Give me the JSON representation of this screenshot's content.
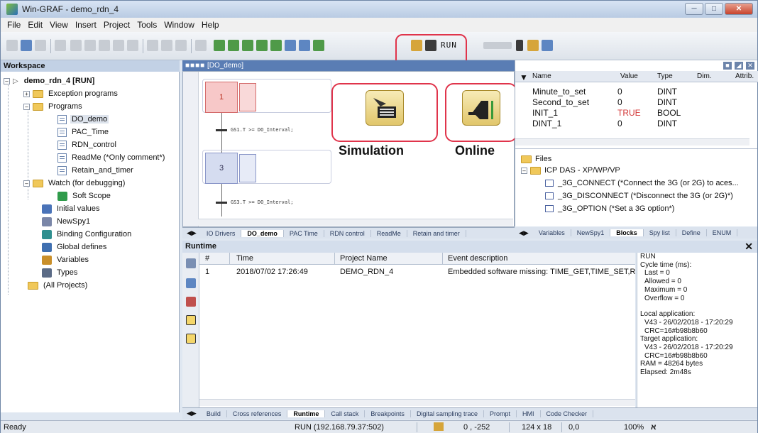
{
  "window": {
    "title": "Win-GRAF  - demo_rdn_4"
  },
  "menu": [
    "File",
    "Edit",
    "View",
    "Insert",
    "Project",
    "Tools",
    "Window",
    "Help"
  ],
  "toolbar": {
    "run_label": "RUN"
  },
  "workspace": {
    "header": "Workspace",
    "tree": [
      {
        "label": "demo_rdn_4 [RUN]",
        "icon": "project-icon",
        "level": 0,
        "bold": true
      },
      {
        "label": "Exception programs",
        "icon": "folder-icon",
        "level": 1
      },
      {
        "label": "Programs",
        "icon": "folder-icon",
        "level": 1
      },
      {
        "label": "DO_demo",
        "icon": "program-icon",
        "level": 2,
        "selected": true
      },
      {
        "label": "PAC_Time",
        "icon": "program-icon",
        "level": 2
      },
      {
        "label": "RDN_control",
        "icon": "program-icon",
        "level": 2
      },
      {
        "label": "ReadMe (*Only comment*)",
        "icon": "program-icon",
        "level": 2
      },
      {
        "label": "Retain_and_timer",
        "icon": "program-icon",
        "level": 2
      },
      {
        "label": "Watch (for debugging)",
        "icon": "folder-icon",
        "level": 1
      },
      {
        "label": "Soft Scope",
        "icon": "scope-icon",
        "level": 2
      },
      {
        "label": "Initial values",
        "icon": "initial-values-icon",
        "level": 1
      },
      {
        "label": "NewSpy1",
        "icon": "spy-icon",
        "level": 1
      },
      {
        "label": "Binding Configuration",
        "icon": "binding-icon",
        "level": 1
      },
      {
        "label": "Global defines",
        "icon": "defines-icon",
        "level": 1
      },
      {
        "label": "Variables",
        "icon": "variables-icon",
        "level": 1
      },
      {
        "label": "Types",
        "icon": "types-icon",
        "level": 1
      },
      {
        "label": "(All Projects)",
        "icon": "folder-icon",
        "level": 0
      }
    ]
  },
  "editor": {
    "title": "[DO_demo]",
    "steps": [
      "1",
      "3"
    ],
    "transitions": [
      "GS1.T >= DO_Interval;",
      "GS3.T >= DO_Interval;"
    ],
    "tabs": [
      "IO Drivers",
      "DO_demo",
      "PAC Time",
      "RDN control",
      "ReadMe",
      "Retain and timer"
    ],
    "active_tab": "DO_demo"
  },
  "callouts": {
    "simulation": "Simulation",
    "online": "Online"
  },
  "variables": {
    "columns": [
      "Name",
      "Value",
      "Type",
      "Dim.",
      "Attrib."
    ],
    "rows": [
      {
        "name": "Minute_to_set",
        "value": "0",
        "type": "DINT"
      },
      {
        "name": "Second_to_set",
        "value": "0",
        "type": "DINT"
      },
      {
        "name": "INIT_1",
        "value": "TRUE",
        "type": "BOOL"
      },
      {
        "name": "DINT_1",
        "value": "0",
        "type": "DINT"
      }
    ]
  },
  "blocks": {
    "items": [
      {
        "label": "Files",
        "icon": "folder-icon"
      },
      {
        "label": "ICP DAS - XP/WP/VP",
        "icon": "folder-icon"
      },
      {
        "label": "_3G_CONNECT (*Connect the 3G (or 2G) to aces...",
        "icon": "function-block-icon"
      },
      {
        "label": "_3G_DISCONNECT (*Disconnect the 3G (or 2G)*)",
        "icon": "function-block-icon"
      },
      {
        "label": "_3G_OPTION (*Set a 3G option*)",
        "icon": "function-block-icon"
      }
    ],
    "tabs": [
      "Variables",
      "NewSpy1",
      "Blocks",
      "Spy list",
      "Define",
      "ENUM"
    ]
  },
  "runtime": {
    "header": "Runtime",
    "columns": [
      "#",
      "Time",
      "Project Name",
      "Event description"
    ],
    "rows": [
      {
        "num": "1",
        "time": "2018/07/02 17:26:49",
        "project": "DEMO_RDN_4",
        "event": "Embedded software missing: TIME_GET,TIME_SET,RI"
      }
    ],
    "info": [
      "RUN",
      "Cycle time (ms):",
      "  Last = 0",
      "  Allowed = 0",
      "  Maximum = 0",
      "  Overflow = 0",
      "",
      "Local application:",
      "  V43 - 26/02/2018 - 17:20:29",
      "  CRC=16#b98b8b60",
      "Target application:",
      "  V43 - 26/02/2018 - 17:20:29",
      "  CRC=16#b98b8b60",
      "RAM = 48264 bytes",
      "Elapsed: 2m48s"
    ],
    "tabs": [
      "Build",
      "Cross references",
      "Runtime",
      "Call stack",
      "Breakpoints",
      "Digital sampling trace",
      "Prompt",
      "HMI",
      "Code Checker"
    ],
    "active_tab": "Runtime"
  },
  "status": {
    "ready": "Ready",
    "connection": "RUN (192.168.79.37:502)",
    "coords": "0 , -252",
    "size": "124 x 18",
    "pos": "0,0",
    "zoom": "100%"
  }
}
